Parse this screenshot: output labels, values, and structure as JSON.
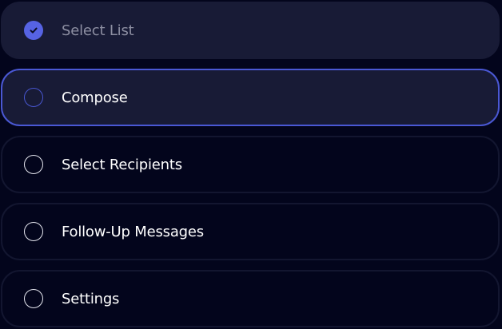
{
  "steps": [
    {
      "label": "Select List",
      "state": "completed",
      "icon": "check-icon"
    },
    {
      "label": "Compose",
      "state": "active",
      "icon": "circle-icon"
    },
    {
      "label": "Select Recipients",
      "state": "pending",
      "icon": "circle-icon"
    },
    {
      "label": "Follow-Up Messages",
      "state": "pending",
      "icon": "circle-icon"
    },
    {
      "label": "Settings",
      "state": "pending",
      "icon": "circle-icon"
    }
  ],
  "colors": {
    "background": "#03051c",
    "card_filled": "#181b36",
    "card_border": "#131630",
    "accent": "#4a58d4",
    "check_fill": "#5663e3",
    "label_muted": "#8d8fa2",
    "label": "#ffffff"
  }
}
